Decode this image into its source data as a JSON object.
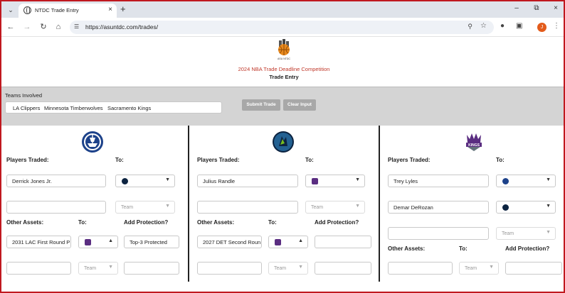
{
  "browser": {
    "tab_title": "NTDC Trade Entry",
    "url": "https://asuntdc.com/trades/",
    "profile_initial": "J"
  },
  "header": {
    "logo_text": "ASU NTDC",
    "competition_title": "2024 NBA Trade Deadline Competition",
    "page_title": "Trade Entry"
  },
  "teams_bar": {
    "label": "Teams Involved",
    "teams": [
      "LA Clippers",
      "Minnesota Timberwolves",
      "Sacramento Kings"
    ],
    "submit_label": "Submit Trade",
    "clear_label": "Clear Input"
  },
  "labels": {
    "players_traded": "Players Traded:",
    "to": "To:",
    "other_assets": "Other Assets:",
    "add_protection": "Add Protection?",
    "team_placeholder": "Team"
  },
  "columns": [
    {
      "team": "LA Clippers",
      "players": [
        "Derrick Jones Jr.",
        ""
      ],
      "players_to": [
        "Minnesota Timberwolves",
        ""
      ],
      "assets": [
        "2031 LAC First Round P",
        ""
      ],
      "assets_to": [
        "Sacramento Kings",
        ""
      ],
      "protection": [
        "Top-3 Protected",
        ""
      ]
    },
    {
      "team": "Minnesota Timberwolves",
      "players": [
        "Julius Randle",
        ""
      ],
      "players_to": [
        "Sacramento Kings",
        ""
      ],
      "assets": [
        "2027 DET Second Roun",
        ""
      ],
      "assets_to": [
        "Sacramento Kings",
        ""
      ],
      "protection": [
        "",
        ""
      ]
    },
    {
      "team": "Sacramento Kings",
      "logo_text": "KINGS",
      "players": [
        "Trey Lyles",
        "Demar DeRozan",
        ""
      ],
      "players_to": [
        "LA Clippers",
        "Minnesota Timberwolves",
        ""
      ],
      "assets": [
        ""
      ],
      "assets_to": [
        ""
      ],
      "protection": [
        ""
      ]
    }
  ],
  "colors": {
    "accent_red": "#c0181f",
    "clippers": "#1d428a",
    "wolves": "#0c2340",
    "kings": "#5a2d81"
  }
}
